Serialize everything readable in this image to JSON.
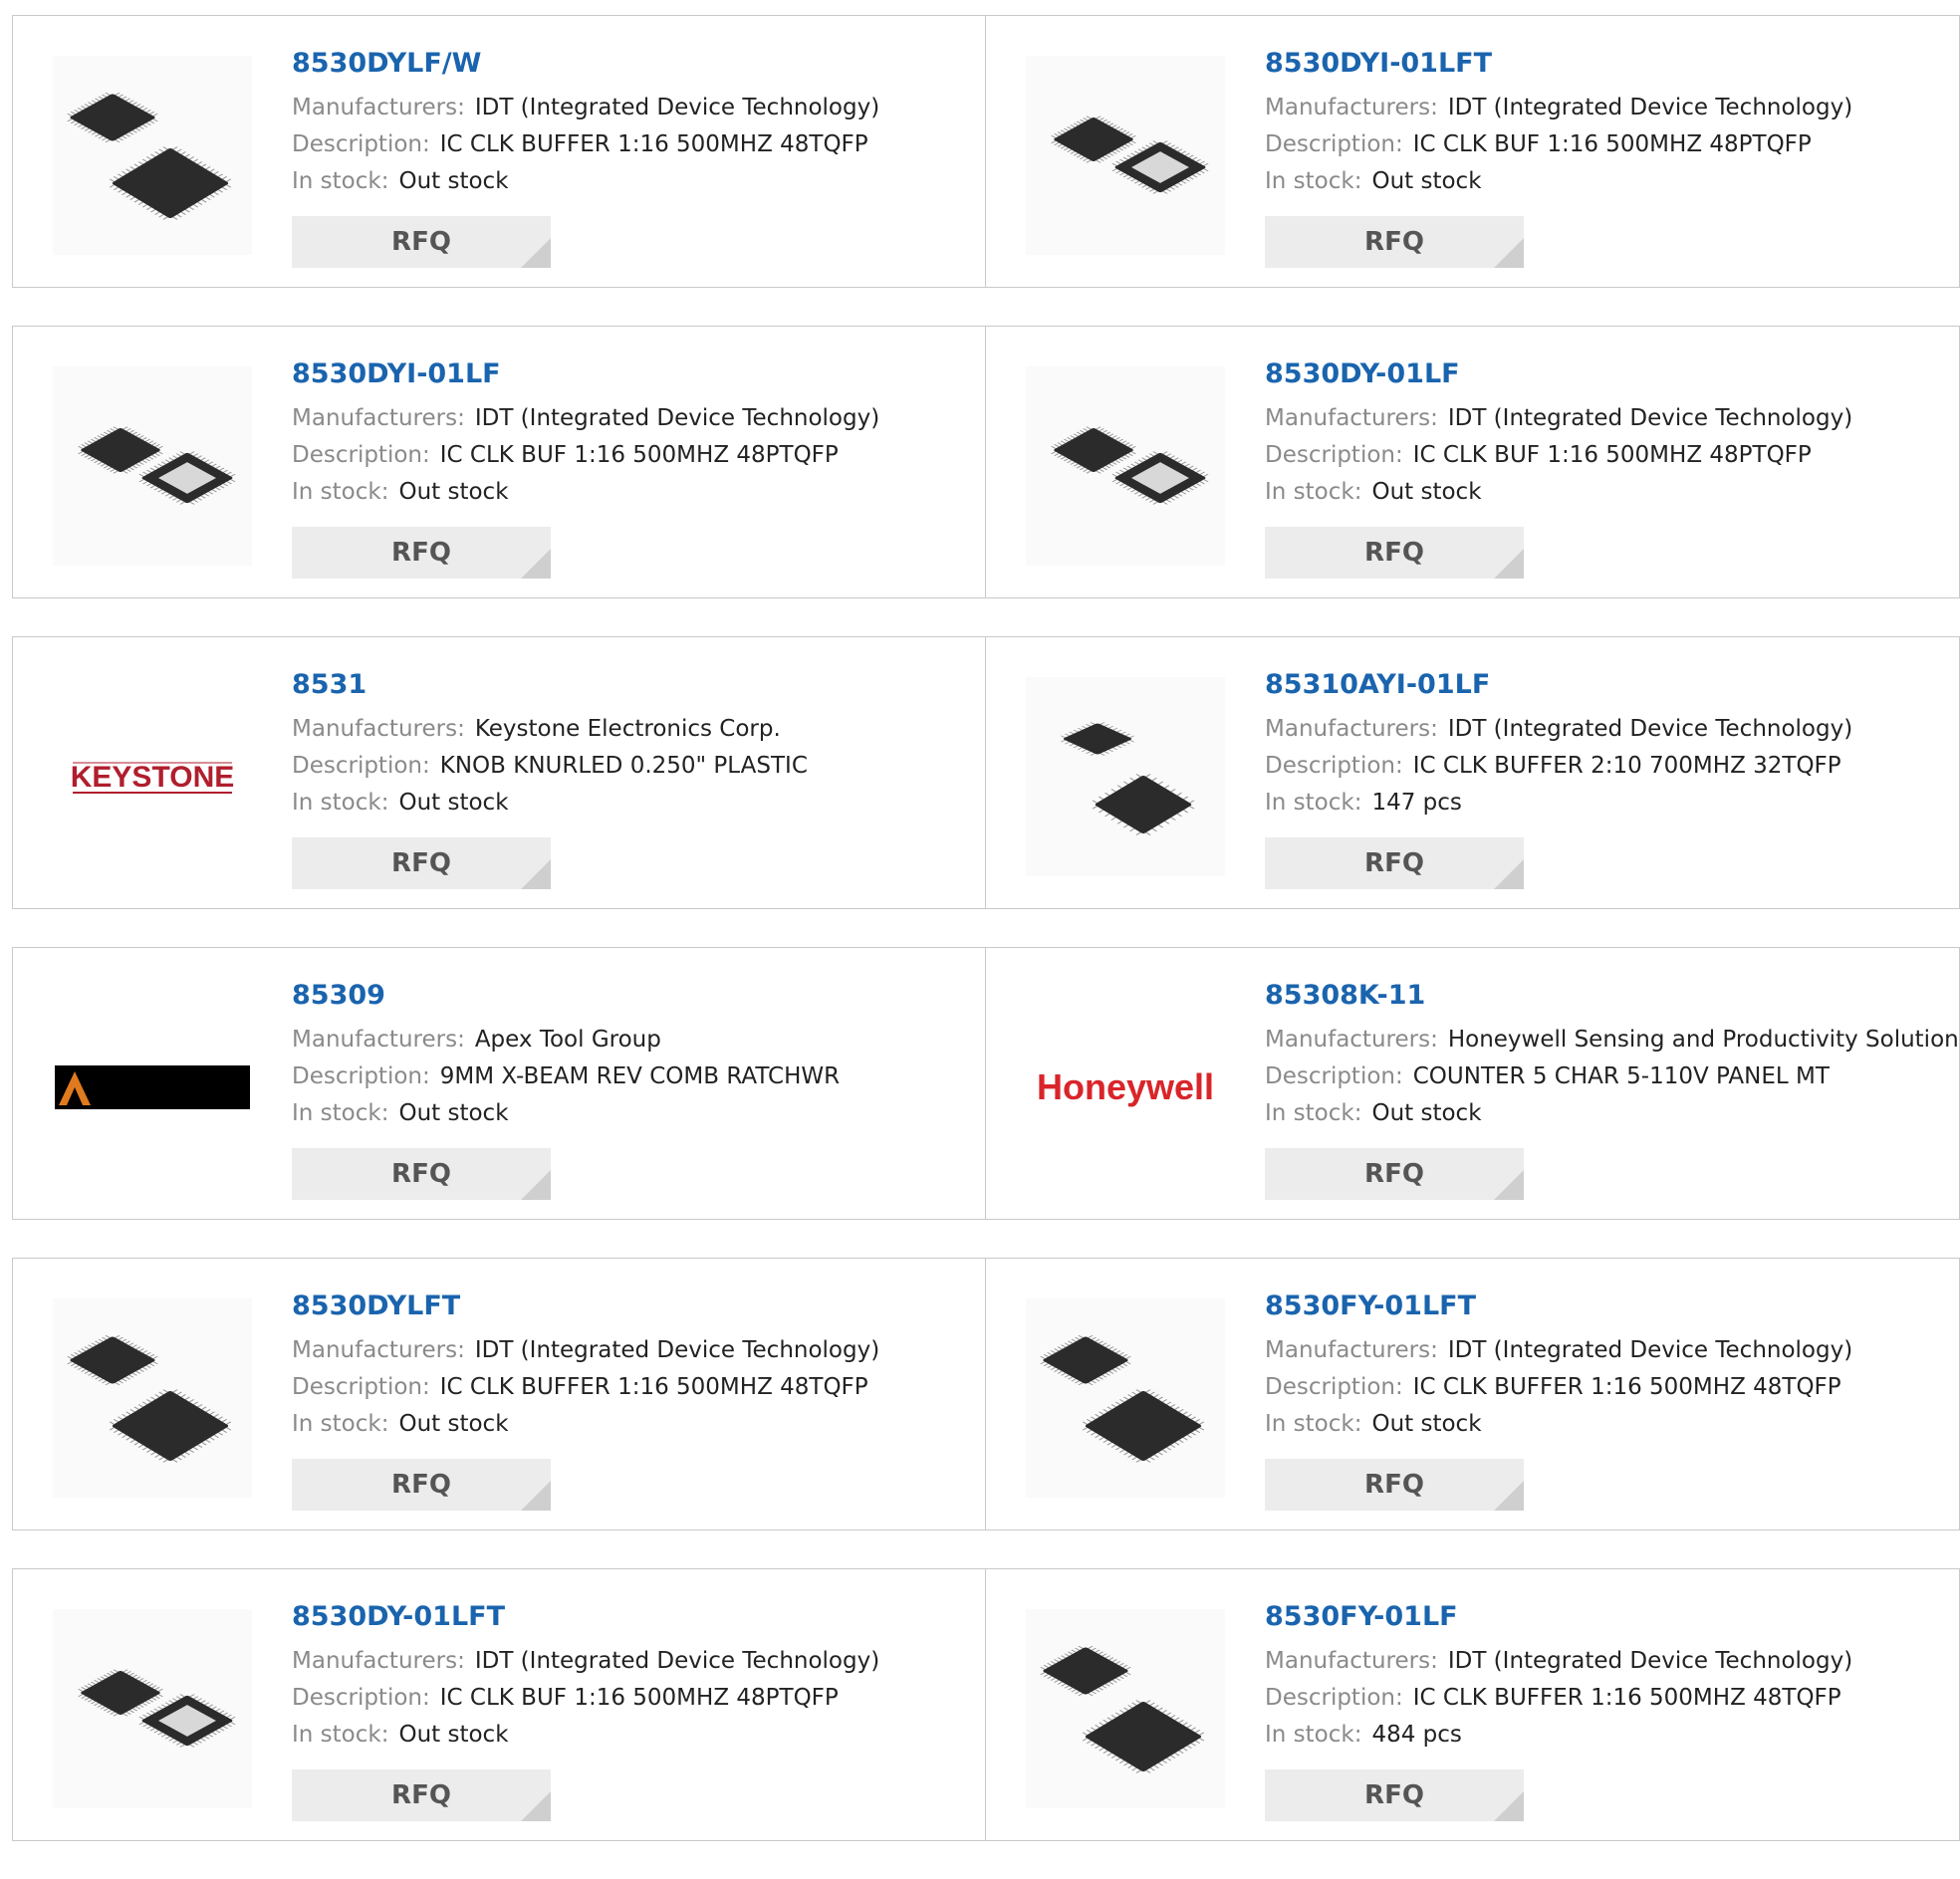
{
  "labels": {
    "manufacturers": "Manufacturers:",
    "description": "Description:",
    "in_stock": "In stock:",
    "rfq": "RFQ"
  },
  "products": [
    {
      "part": "8530DYLF/W",
      "manufacturer": "IDT (Integrated Device Technology)",
      "description": "IC CLK BUFFER 1:16 500MHZ 48TQFP",
      "stock": "Out stock",
      "image": "chip-pair-icon"
    },
    {
      "part": "8530DYI-01LFT",
      "manufacturer": "IDT (Integrated Device Technology)",
      "description": "IC CLK BUF 1:16 500MHZ 48PTQFP",
      "stock": "Out stock",
      "image": "chip-pair-pad-icon"
    },
    {
      "part": "8530DYI-01LF",
      "manufacturer": "IDT (Integrated Device Technology)",
      "description": "IC CLK BUF 1:16 500MHZ 48PTQFP",
      "stock": "Out stock",
      "image": "chip-pair-pad-icon"
    },
    {
      "part": "8530DY-01LF",
      "manufacturer": "IDT (Integrated Device Technology)",
      "description": "IC CLK BUF 1:16 500MHZ 48PTQFP",
      "stock": "Out stock",
      "image": "chip-pair-pad-icon"
    },
    {
      "part": "8531",
      "manufacturer": "Keystone Electronics Corp.",
      "description": "KNOB KNURLED 0.250\" PLASTIC",
      "stock": "Out stock",
      "image": "keystone-logo",
      "logo_text": "KEYSTONE"
    },
    {
      "part": "85310AYI-01LF",
      "manufacturer": "IDT (Integrated Device Technology)",
      "description": "IC CLK BUFFER 2:10 700MHZ 32TQFP",
      "stock": "147 pcs",
      "image": "chip-small-icon"
    },
    {
      "part": "85309",
      "manufacturer": "Apex Tool Group",
      "description": "9MM X-BEAM REV COMB RATCHWR",
      "stock": "Out stock",
      "image": "apex-logo"
    },
    {
      "part": "85308K-11",
      "manufacturer": "Honeywell Sensing and Productivity Solutions",
      "description": "COUNTER 5 CHAR 5-110V PANEL MT",
      "stock": "Out stock",
      "image": "honeywell-logo",
      "logo_text": "Honeywell"
    },
    {
      "part": "8530DYLFT",
      "manufacturer": "IDT (Integrated Device Technology)",
      "description": "IC CLK BUFFER 1:16 500MHZ 48TQFP",
      "stock": "Out stock",
      "image": "chip-pair-icon"
    },
    {
      "part": "8530FY-01LFT",
      "manufacturer": "IDT (Integrated Device Technology)",
      "description": "IC CLK BUFFER 1:16 500MHZ 48TQFP",
      "stock": "Out stock",
      "image": "chip-pair-icon"
    },
    {
      "part": "8530DY-01LFT",
      "manufacturer": "IDT (Integrated Device Technology)",
      "description": "IC CLK BUF 1:16 500MHZ 48PTQFP",
      "stock": "Out stock",
      "image": "chip-pair-pad-icon"
    },
    {
      "part": "8530FY-01LF",
      "manufacturer": "IDT (Integrated Device Technology)",
      "description": "IC CLK BUFFER 1:16 500MHZ 48TQFP",
      "stock": "484 pcs",
      "image": "chip-pair-icon"
    }
  ],
  "colors": {
    "link": "#1a64ae",
    "label": "#8a8a8a",
    "rfq_bg": "#ececec",
    "keystone": "#b01e2e",
    "honeywell": "#d9252a"
  }
}
